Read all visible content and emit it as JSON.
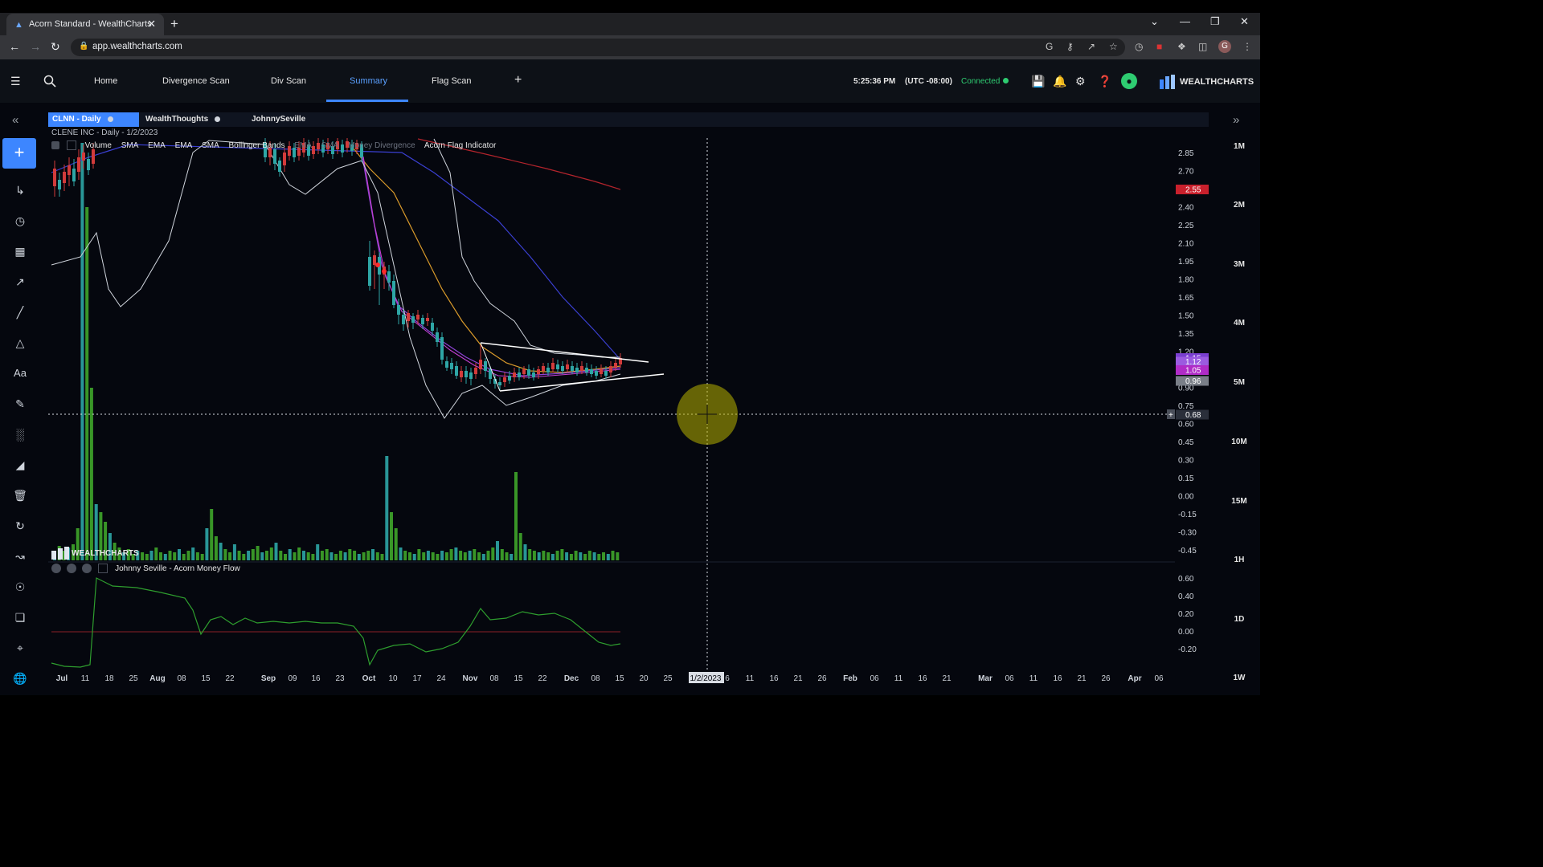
{
  "browser": {
    "tab_title": "Acorn Standard - WealthCharts",
    "url": "app.wealthcharts.com"
  },
  "header": {
    "nav": [
      "Home",
      "Divergence Scan",
      "Div Scan",
      "Summary",
      "Flag Scan"
    ],
    "active_nav": "Summary",
    "time": "5:25:36 PM",
    "timezone": "(UTC -08:00)",
    "status": "Connected",
    "brand": "WEALTHCHARTS"
  },
  "chart_tabs": [
    {
      "label": "CLNN - Daily",
      "active": true
    },
    {
      "label": "WealthThoughts",
      "active": false
    },
    {
      "label": "JohnnySeville",
      "active": false
    }
  ],
  "chart_header": {
    "ticker_line": "CLENE INC - Daily - 1/2/2023",
    "indicators": [
      "Volume",
      "SMA",
      "EMA",
      "EMA",
      "SMA",
      "Bollinger Bands",
      "EMA",
      "SMA",
      "Money Divergence",
      "Acorn Flag Indicator"
    ],
    "lower_pane_title": "Johnny Seville - Acorn Money Flow",
    "watermark": "WEALTHCHARTS"
  },
  "timeframes": [
    "1M",
    "2M",
    "3M",
    "4M",
    "5M",
    "10M",
    "15M",
    "1H",
    "1D",
    "1W"
  ],
  "colors": {
    "accent": "#3d86ff",
    "up": "#2ea6a6",
    "down": "#d23b3b",
    "volume": "#3fa62a",
    "connected": "#2ecc71"
  },
  "icons": [
    "menu-icon",
    "search-icon",
    "add-icon",
    "save-icon",
    "bell-icon",
    "gear-icon",
    "help-icon",
    "lightbulb-icon"
  ],
  "chart_data": {
    "type": "line",
    "title": "CLENE INC - Daily - 1/2/2023",
    "price_axis_ticks": [
      2.85,
      2.7,
      2.55,
      2.4,
      2.25,
      2.1,
      1.95,
      1.8,
      1.65,
      1.5,
      1.35,
      1.2,
      1.05,
      0.9,
      0.75,
      0.6,
      0.45,
      0.3,
      0.15,
      0.0,
      -0.15,
      -0.3,
      -0.45
    ],
    "price_tick_labels": [
      "2.85",
      "2.70",
      "2.55",
      "2.40",
      "2.25",
      "2.10",
      "1.95",
      "1.80",
      "1.65",
      "1.50",
      "1.35",
      "1.20",
      "1.05",
      "0.90",
      "0.75",
      "0.60",
      "0.45",
      "0.30",
      "0.15",
      "0.00",
      "-0.15",
      "-0.30",
      "-0.45"
    ],
    "price_markers": [
      {
        "label": "2.55",
        "value": 2.55,
        "color": "#c9202c"
      },
      {
        "label": "1.15",
        "value": 1.15,
        "color": "#7a3fd0"
      },
      {
        "label": "1.12",
        "value": 1.12,
        "color": "#9b5be0"
      },
      {
        "label": "1.05",
        "value": 1.05,
        "color": "#b02cc7"
      },
      {
        "label": "0.96",
        "value": 0.96,
        "color": "#7a7f88"
      },
      {
        "label": "0.68",
        "value": 0.68,
        "color": "#2a2f3a"
      }
    ],
    "lower_axis_ticks": [
      0.6,
      0.4,
      0.2,
      0.0,
      -0.2
    ],
    "lower_tick_labels": [
      "0.60",
      "0.40",
      "0.20",
      "0.00",
      "-0.20"
    ],
    "x_tick_labels": [
      "Jul",
      "11",
      "18",
      "25",
      "Aug",
      "08",
      "15",
      "22",
      "Sep",
      "09",
      "16",
      "23",
      "Oct",
      "10",
      "17",
      "24",
      "Nov",
      "08",
      "15",
      "22",
      "Dec",
      "08",
      "15",
      "20",
      "25",
      "1/2/2023",
      "6",
      "11",
      "16",
      "21",
      "26",
      "Feb",
      "06",
      "11",
      "16",
      "21",
      "Mar",
      "06",
      "11",
      "16",
      "21",
      "26",
      "Apr",
      "06"
    ],
    "crosshair": {
      "price": "0.68",
      "date": "1/2/2023"
    },
    "close_series": [
      2.6,
      2.65,
      2.7,
      2.85,
      2.95,
      2.8,
      2.7,
      2.75,
      2.9,
      2.85,
      2.8,
      2.75,
      2.7,
      1.95,
      1.85,
      1.7,
      1.6,
      1.5,
      1.55,
      1.45,
      1.4,
      1.3,
      1.15,
      1.05,
      1.0,
      0.98,
      1.0,
      1.02,
      1.05,
      1.0,
      0.98,
      0.97,
      1.02,
      1.05,
      1.06,
      1.08,
      1.05,
      1.03,
      1.04,
      1.06,
      1.1
    ]
  }
}
